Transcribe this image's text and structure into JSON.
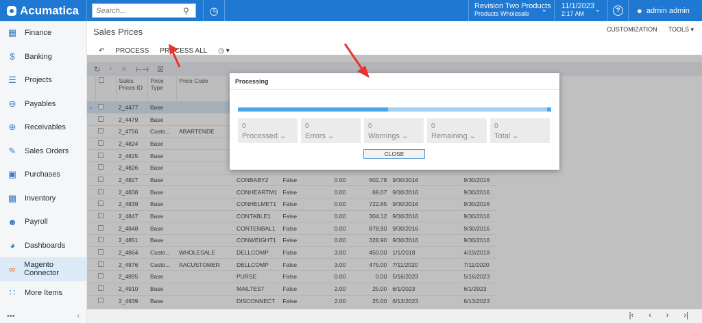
{
  "app": {
    "brand": "Acumatica"
  },
  "topbar": {
    "search_placeholder": "Search...",
    "tenant_line1": "Revision Two Products",
    "tenant_line2": "Products Wholesale",
    "date": "11/1/2023",
    "time": "2:17 AM",
    "user": "admin admin"
  },
  "sidebar": {
    "items": [
      {
        "label": "Finance",
        "icon": "calculator-icon"
      },
      {
        "label": "Banking",
        "icon": "dollar-icon"
      },
      {
        "label": "Projects",
        "icon": "list-icon"
      },
      {
        "label": "Payables",
        "icon": "minus-circle-icon"
      },
      {
        "label": "Receivables",
        "icon": "plus-circle-icon"
      },
      {
        "label": "Sales Orders",
        "icon": "edit-icon"
      },
      {
        "label": "Purchases",
        "icon": "cart-icon"
      },
      {
        "label": "Inventory",
        "icon": "truck-icon"
      },
      {
        "label": "Payroll",
        "icon": "person-dollar-icon"
      },
      {
        "label": "Dashboards",
        "icon": "gauge-icon"
      },
      {
        "label": "Magento Connector",
        "icon": "magento-icon"
      },
      {
        "label": "More Items",
        "icon": "grid-icon"
      }
    ]
  },
  "page": {
    "title": "Sales Prices",
    "customization": "CUSTOMIZATION",
    "tools": "TOOLS"
  },
  "toolbar": {
    "process": "PROCESS",
    "process_all": "PROCESS ALL"
  },
  "table": {
    "headers": [
      "Sales Prices ID",
      "Price Type",
      "Price Code"
    ],
    "rows": [
      [
        "2_4477",
        "Base",
        "",
        "",
        "",
        "",
        "",
        "",
        ""
      ],
      [
        "2_4479",
        "Base",
        "",
        "",
        "",
        "",
        "",
        "",
        ""
      ],
      [
        "2_4756",
        "Custo...",
        "ABARTENDE",
        "",
        "",
        "",
        "",
        "",
        ""
      ],
      [
        "2_4824",
        "Base",
        "",
        "",
        "",
        "",
        "",
        "",
        ""
      ],
      [
        "2_4825",
        "Base",
        "",
        "",
        "",
        "",
        "",
        "",
        ""
      ],
      [
        "2_4826",
        "Base",
        "",
        "",
        "",
        "",
        "",
        "",
        ""
      ],
      [
        "2_4827",
        "Base",
        "",
        "CONBABY2",
        "False",
        "0.00",
        "602.78",
        "9/30/2016",
        "9/30/2016"
      ],
      [
        "2_4838",
        "Base",
        "",
        "CONHEARTM1",
        "False",
        "0.00",
        "69.07",
        "9/30/2016",
        "9/30/2016"
      ],
      [
        "2_4839",
        "Base",
        "",
        "CONHELMET1",
        "False",
        "0.00",
        "722.65",
        "9/30/2016",
        "9/30/2016"
      ],
      [
        "2_4847",
        "Base",
        "",
        "CONTABLE1",
        "False",
        "0.00",
        "304.12",
        "9/30/2016",
        "9/30/2016"
      ],
      [
        "2_4848",
        "Base",
        "",
        "CONTENBAL1",
        "False",
        "0.00",
        "878.90",
        "9/30/2016",
        "9/30/2016"
      ],
      [
        "2_4851",
        "Base",
        "",
        "CONWEIGHT1",
        "False",
        "0.00",
        "328.90",
        "9/30/2016",
        "9/30/2016"
      ],
      [
        "2_4864",
        "Custo...",
        "WHOLESALE",
        "DELLCOMP",
        "False",
        "3.00",
        "450.00",
        "1/1/2018",
        "4/19/2018"
      ],
      [
        "2_4876",
        "Custo...",
        "AACUSTOMER",
        "DELLCOMP",
        "False",
        "3.00",
        "475.00",
        "7/11/2020",
        "7/11/2020"
      ],
      [
        "2_4895",
        "Base",
        "",
        "PURSE",
        "False",
        "0.00",
        "0.00",
        "5/16/2023",
        "5/16/2023"
      ],
      [
        "2_4910",
        "Base",
        "",
        "MAILTEST",
        "False",
        "2.00",
        "25.00",
        "6/1/2023",
        "6/1/2023"
      ],
      [
        "2_4939",
        "Base",
        "",
        "DISCONNECT",
        "False",
        "2.00",
        "25.00",
        "6/13/2023",
        "6/13/2023"
      ]
    ]
  },
  "dialog": {
    "title": "Processing",
    "progress": 0.48,
    "stats": [
      {
        "value": "0",
        "label": "Processed"
      },
      {
        "value": "0",
        "label": "Errors"
      },
      {
        "value": "0",
        "label": "Warnings"
      },
      {
        "value": "0",
        "label": "Remaining"
      },
      {
        "value": "0",
        "label": "Total"
      }
    ],
    "close": "CLOSE"
  },
  "colors": {
    "brand": "#1f78d1",
    "annotation_arrow": "#e8322d"
  }
}
